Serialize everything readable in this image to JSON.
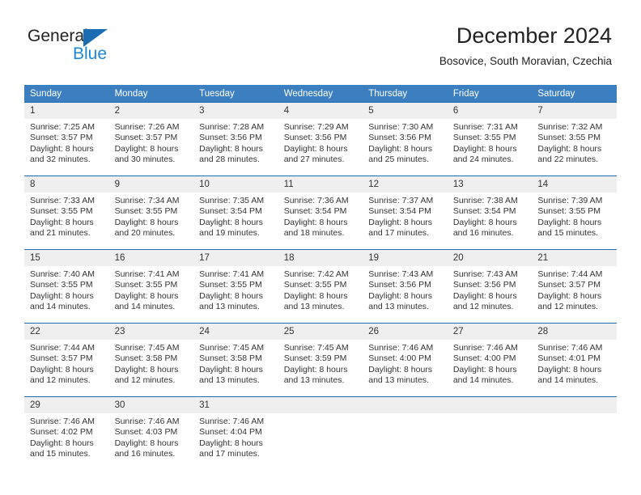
{
  "brand": {
    "line1": "General",
    "line2": "Blue",
    "triangle_color": "#1b6cb3",
    "line2_color": "#1f86d8"
  },
  "header": {
    "title": "December 2024",
    "subtitle": "Bosovice, South Moravian, Czechia"
  },
  "theme": {
    "header_bg": "#3c7fc1",
    "cell_top_border": "#1f6bb0",
    "daynum_bg": "#efefef",
    "text": "#333333"
  },
  "weekday_headers": [
    "Sunday",
    "Monday",
    "Tuesday",
    "Wednesday",
    "Thursday",
    "Friday",
    "Saturday"
  ],
  "weeks": [
    [
      {
        "day": "1",
        "sunrise": "Sunrise: 7:25 AM",
        "sunset": "Sunset: 3:57 PM",
        "daylight1": "Daylight: 8 hours",
        "daylight2": "and 32 minutes."
      },
      {
        "day": "2",
        "sunrise": "Sunrise: 7:26 AM",
        "sunset": "Sunset: 3:57 PM",
        "daylight1": "Daylight: 8 hours",
        "daylight2": "and 30 minutes."
      },
      {
        "day": "3",
        "sunrise": "Sunrise: 7:28 AM",
        "sunset": "Sunset: 3:56 PM",
        "daylight1": "Daylight: 8 hours",
        "daylight2": "and 28 minutes."
      },
      {
        "day": "4",
        "sunrise": "Sunrise: 7:29 AM",
        "sunset": "Sunset: 3:56 PM",
        "daylight1": "Daylight: 8 hours",
        "daylight2": "and 27 minutes."
      },
      {
        "day": "5",
        "sunrise": "Sunrise: 7:30 AM",
        "sunset": "Sunset: 3:56 PM",
        "daylight1": "Daylight: 8 hours",
        "daylight2": "and 25 minutes."
      },
      {
        "day": "6",
        "sunrise": "Sunrise: 7:31 AM",
        "sunset": "Sunset: 3:55 PM",
        "daylight1": "Daylight: 8 hours",
        "daylight2": "and 24 minutes."
      },
      {
        "day": "7",
        "sunrise": "Sunrise: 7:32 AM",
        "sunset": "Sunset: 3:55 PM",
        "daylight1": "Daylight: 8 hours",
        "daylight2": "and 22 minutes."
      }
    ],
    [
      {
        "day": "8",
        "sunrise": "Sunrise: 7:33 AM",
        "sunset": "Sunset: 3:55 PM",
        "daylight1": "Daylight: 8 hours",
        "daylight2": "and 21 minutes."
      },
      {
        "day": "9",
        "sunrise": "Sunrise: 7:34 AM",
        "sunset": "Sunset: 3:55 PM",
        "daylight1": "Daylight: 8 hours",
        "daylight2": "and 20 minutes."
      },
      {
        "day": "10",
        "sunrise": "Sunrise: 7:35 AM",
        "sunset": "Sunset: 3:54 PM",
        "daylight1": "Daylight: 8 hours",
        "daylight2": "and 19 minutes."
      },
      {
        "day": "11",
        "sunrise": "Sunrise: 7:36 AM",
        "sunset": "Sunset: 3:54 PM",
        "daylight1": "Daylight: 8 hours",
        "daylight2": "and 18 minutes."
      },
      {
        "day": "12",
        "sunrise": "Sunrise: 7:37 AM",
        "sunset": "Sunset: 3:54 PM",
        "daylight1": "Daylight: 8 hours",
        "daylight2": "and 17 minutes."
      },
      {
        "day": "13",
        "sunrise": "Sunrise: 7:38 AM",
        "sunset": "Sunset: 3:54 PM",
        "daylight1": "Daylight: 8 hours",
        "daylight2": "and 16 minutes."
      },
      {
        "day": "14",
        "sunrise": "Sunrise: 7:39 AM",
        "sunset": "Sunset: 3:55 PM",
        "daylight1": "Daylight: 8 hours",
        "daylight2": "and 15 minutes."
      }
    ],
    [
      {
        "day": "15",
        "sunrise": "Sunrise: 7:40 AM",
        "sunset": "Sunset: 3:55 PM",
        "daylight1": "Daylight: 8 hours",
        "daylight2": "and 14 minutes."
      },
      {
        "day": "16",
        "sunrise": "Sunrise: 7:41 AM",
        "sunset": "Sunset: 3:55 PM",
        "daylight1": "Daylight: 8 hours",
        "daylight2": "and 14 minutes."
      },
      {
        "day": "17",
        "sunrise": "Sunrise: 7:41 AM",
        "sunset": "Sunset: 3:55 PM",
        "daylight1": "Daylight: 8 hours",
        "daylight2": "and 13 minutes."
      },
      {
        "day": "18",
        "sunrise": "Sunrise: 7:42 AM",
        "sunset": "Sunset: 3:55 PM",
        "daylight1": "Daylight: 8 hours",
        "daylight2": "and 13 minutes."
      },
      {
        "day": "19",
        "sunrise": "Sunrise: 7:43 AM",
        "sunset": "Sunset: 3:56 PM",
        "daylight1": "Daylight: 8 hours",
        "daylight2": "and 13 minutes."
      },
      {
        "day": "20",
        "sunrise": "Sunrise: 7:43 AM",
        "sunset": "Sunset: 3:56 PM",
        "daylight1": "Daylight: 8 hours",
        "daylight2": "and 12 minutes."
      },
      {
        "day": "21",
        "sunrise": "Sunrise: 7:44 AM",
        "sunset": "Sunset: 3:57 PM",
        "daylight1": "Daylight: 8 hours",
        "daylight2": "and 12 minutes."
      }
    ],
    [
      {
        "day": "22",
        "sunrise": "Sunrise: 7:44 AM",
        "sunset": "Sunset: 3:57 PM",
        "daylight1": "Daylight: 8 hours",
        "daylight2": "and 12 minutes."
      },
      {
        "day": "23",
        "sunrise": "Sunrise: 7:45 AM",
        "sunset": "Sunset: 3:58 PM",
        "daylight1": "Daylight: 8 hours",
        "daylight2": "and 12 minutes."
      },
      {
        "day": "24",
        "sunrise": "Sunrise: 7:45 AM",
        "sunset": "Sunset: 3:58 PM",
        "daylight1": "Daylight: 8 hours",
        "daylight2": "and 13 minutes."
      },
      {
        "day": "25",
        "sunrise": "Sunrise: 7:45 AM",
        "sunset": "Sunset: 3:59 PM",
        "daylight1": "Daylight: 8 hours",
        "daylight2": "and 13 minutes."
      },
      {
        "day": "26",
        "sunrise": "Sunrise: 7:46 AM",
        "sunset": "Sunset: 4:00 PM",
        "daylight1": "Daylight: 8 hours",
        "daylight2": "and 13 minutes."
      },
      {
        "day": "27",
        "sunrise": "Sunrise: 7:46 AM",
        "sunset": "Sunset: 4:00 PM",
        "daylight1": "Daylight: 8 hours",
        "daylight2": "and 14 minutes."
      },
      {
        "day": "28",
        "sunrise": "Sunrise: 7:46 AM",
        "sunset": "Sunset: 4:01 PM",
        "daylight1": "Daylight: 8 hours",
        "daylight2": "and 14 minutes."
      }
    ],
    [
      {
        "day": "29",
        "sunrise": "Sunrise: 7:46 AM",
        "sunset": "Sunset: 4:02 PM",
        "daylight1": "Daylight: 8 hours",
        "daylight2": "and 15 minutes."
      },
      {
        "day": "30",
        "sunrise": "Sunrise: 7:46 AM",
        "sunset": "Sunset: 4:03 PM",
        "daylight1": "Daylight: 8 hours",
        "daylight2": "and 16 minutes."
      },
      {
        "day": "31",
        "sunrise": "Sunrise: 7:46 AM",
        "sunset": "Sunset: 4:04 PM",
        "daylight1": "Daylight: 8 hours",
        "daylight2": "and 17 minutes."
      },
      {
        "day": "",
        "sunrise": "",
        "sunset": "",
        "daylight1": "",
        "daylight2": ""
      },
      {
        "day": "",
        "sunrise": "",
        "sunset": "",
        "daylight1": "",
        "daylight2": ""
      },
      {
        "day": "",
        "sunrise": "",
        "sunset": "",
        "daylight1": "",
        "daylight2": ""
      },
      {
        "day": "",
        "sunrise": "",
        "sunset": "",
        "daylight1": "",
        "daylight2": ""
      }
    ]
  ]
}
